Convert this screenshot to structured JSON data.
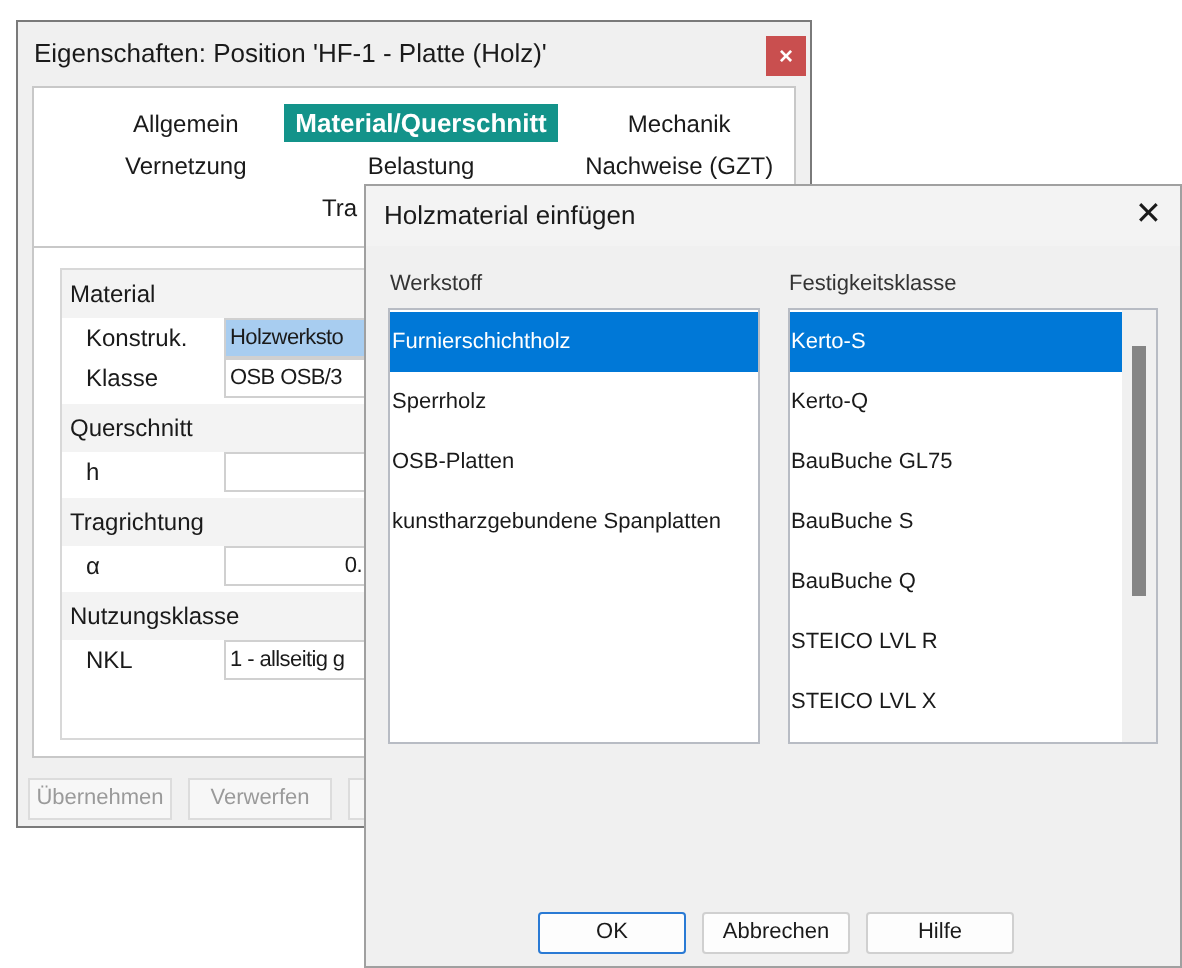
{
  "window": {
    "title": "Eigenschaften: Position 'HF-1 - Platte (Holz)'",
    "close": "×"
  },
  "tabs": [
    [
      {
        "label": "Allgemein",
        "selected": false
      },
      {
        "label": "Material/Querschnitt",
        "selected": true
      },
      {
        "label": "Mechanik",
        "selected": false
      }
    ],
    [
      {
        "label": "Vernetzung",
        "selected": false
      },
      {
        "label": "Belastung",
        "selected": false
      },
      {
        "label": "Nachweise (GZT)",
        "selected": false
      }
    ],
    [
      {
        "label": "Tra",
        "selected": false
      }
    ]
  ],
  "properties": [
    {
      "heading": "Material",
      "rows": [
        {
          "label": "Konstruk.",
          "value": "Holzwerksto",
          "kind": "text",
          "selected": true
        },
        {
          "label": "Klasse",
          "value": "OSB OSB/3",
          "kind": "text",
          "selected": false
        }
      ]
    },
    {
      "heading": "Querschnitt",
      "rows": [
        {
          "label": "h",
          "kind": "number",
          "selected": false
        }
      ]
    },
    {
      "heading": "Tragrichtung",
      "rows": [
        {
          "label": "α",
          "value": "0.",
          "kind": "number",
          "selected": false
        }
      ]
    },
    {
      "heading": "Nutzungsklasse",
      "rows": [
        {
          "label": "NKL",
          "value": "1 - allseitig g",
          "kind": "text",
          "selected": false
        }
      ]
    }
  ],
  "buttons": [
    {
      "label": "Übernehmen",
      "disabled": true
    },
    {
      "label": "Verwerfen",
      "disabled": true
    }
  ],
  "dialog": {
    "title": "Holzmaterial einfügen",
    "close": "✕",
    "lists": [
      {
        "label": "Werkstoff",
        "items": [
          {
            "label": "Furnierschichtholz",
            "selected": true
          },
          {
            "label": "Sperrholz",
            "selected": false
          },
          {
            "label": "OSB-Platten",
            "selected": false
          },
          {
            "label": "kunstharzgebundene Spanplatten",
            "selected": false
          }
        ]
      },
      {
        "label": "Festigkeitsklasse",
        "items": [
          {
            "label": "Kerto-S",
            "selected": true
          },
          {
            "label": "Kerto-Q",
            "selected": false
          },
          {
            "label": "BauBuche GL75",
            "selected": false
          },
          {
            "label": "BauBuche S",
            "selected": false
          },
          {
            "label": "BauBuche Q",
            "selected": false
          },
          {
            "label": "STEICO LVL R",
            "selected": false
          },
          {
            "label": "STEICO LVL X",
            "selected": false
          }
        ]
      }
    ],
    "buttons": [
      {
        "label": "OK",
        "default": true
      },
      {
        "label": "Abbrechen",
        "default": false
      },
      {
        "label": "Hilfe",
        "default": false
      }
    ]
  }
}
